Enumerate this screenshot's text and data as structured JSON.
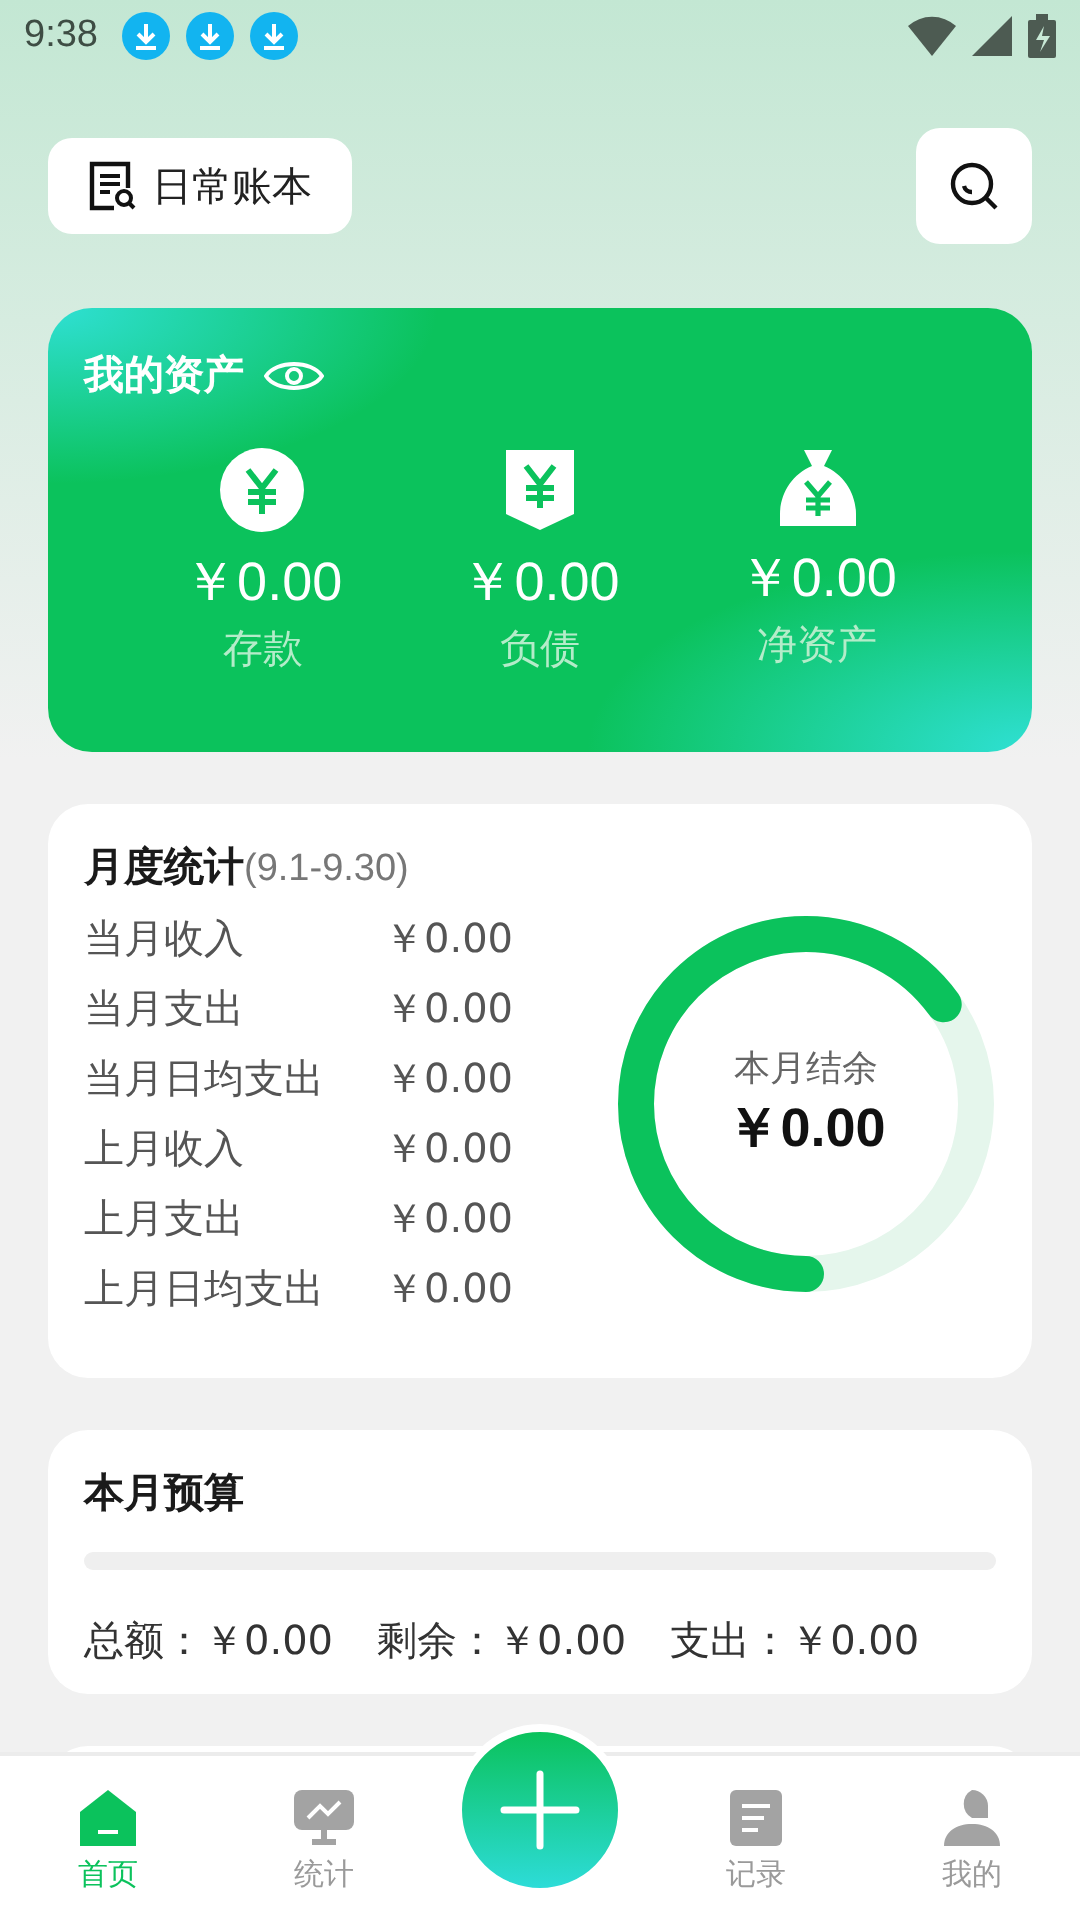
{
  "status_bar": {
    "time": "9:38",
    "notifications": [
      {
        "kind": "download"
      },
      {
        "kind": "download"
      },
      {
        "kind": "download"
      }
    ]
  },
  "header": {
    "book_button": "日常账本"
  },
  "assets": {
    "title": "我的资产",
    "items": [
      {
        "kind": "deposit",
        "amount": "￥0.00",
        "label": "存款"
      },
      {
        "kind": "debt",
        "amount": "￥0.00",
        "label": "负债"
      },
      {
        "kind": "net",
        "amount": "￥0.00",
        "label": "净资产"
      }
    ]
  },
  "monthly": {
    "title": "月度统计",
    "range": "(9.1-9.30)",
    "rows": [
      {
        "label": "当月收入",
        "value": "￥0.00"
      },
      {
        "label": "当月支出",
        "value": "￥0.00"
      },
      {
        "label": "当月日均支出",
        "value": "￥0.00"
      },
      {
        "label": "上月收入",
        "value": "￥0.00"
      },
      {
        "label": "上月支出",
        "value": "￥0.00"
      },
      {
        "label": "上月日均支出",
        "value": "￥0.00"
      }
    ],
    "ring": {
      "label": "本月结余",
      "value": "￥0.00"
    }
  },
  "budget": {
    "title": "本月预算",
    "items": [
      {
        "label": "总额：",
        "value": "￥0.00"
      },
      {
        "label": "剩余：",
        "value": "￥0.00"
      },
      {
        "label": "支出：",
        "value": "￥0.00"
      }
    ]
  },
  "tabs": [
    {
      "kind": "home",
      "label": "首页",
      "selected": true
    },
    {
      "kind": "stats",
      "label": "统计",
      "selected": false
    },
    {
      "kind": "add"
    },
    {
      "kind": "records",
      "label": "记录",
      "selected": false
    },
    {
      "kind": "mine",
      "label": "我的",
      "selected": false
    }
  ]
}
